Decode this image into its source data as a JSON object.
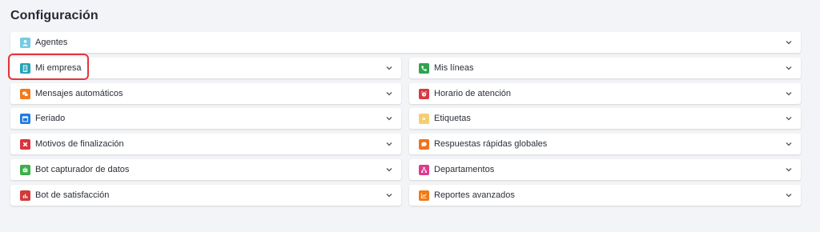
{
  "header": {
    "title": "Configuración"
  },
  "agentes": {
    "label": "Agentes",
    "icon": "user-icon",
    "color": "#74cbe3"
  },
  "left": [
    {
      "label": "Mi empresa",
      "icon": "building-icon",
      "color": "#24a3b8"
    },
    {
      "label": "Mensajes automáticos",
      "icon": "chat-bubbles-icon",
      "color": "#f27a1a"
    },
    {
      "label": "Feriado",
      "icon": "calendar-icon",
      "color": "#1f7be3"
    },
    {
      "label": "Motivos de finalización",
      "icon": "close-x-icon",
      "color": "#d9343d"
    },
    {
      "label": "Bot capturador de datos",
      "icon": "robot-icon",
      "color": "#3cae4a"
    },
    {
      "label": "Bot de satisfacción",
      "icon": "bar-chart-icon",
      "color": "#d33a3a"
    }
  ],
  "right": [
    {
      "label": "Mis líneas",
      "icon": "phone-icon",
      "color": "#2ea44f"
    },
    {
      "label": "Horario de atención",
      "icon": "alarm-clock-icon",
      "color": "#d93843"
    },
    {
      "label": "Etiquetas",
      "icon": "tag-icon",
      "color": "#f6cf72"
    },
    {
      "label": "Respuestas rápidas globales",
      "icon": "speech-bubble-icon",
      "color": "#f0731c"
    },
    {
      "label": "Departamentos",
      "icon": "org-chart-icon",
      "color": "#dc3c8e"
    },
    {
      "label": "Reportes avanzados",
      "icon": "line-chart-icon",
      "color": "#f07a18"
    }
  ],
  "highlight_color": "#e4363b"
}
